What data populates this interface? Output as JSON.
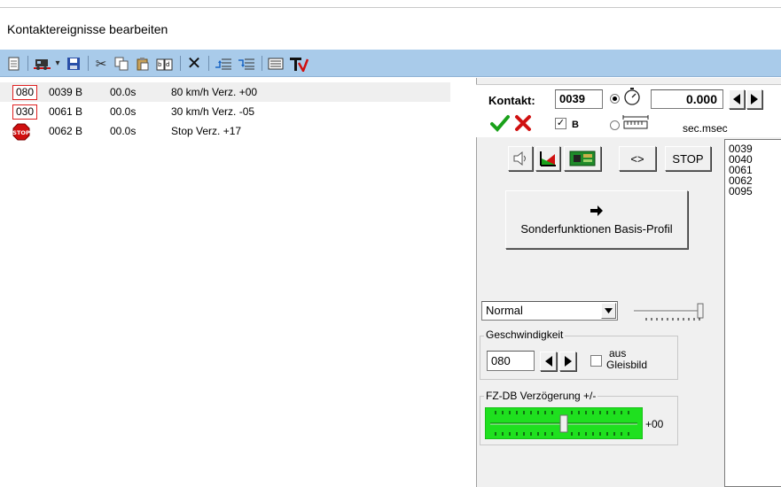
{
  "window": {
    "title": "Kontaktereignisse bearbeiten"
  },
  "toolbar": {
    "buttons": [
      {
        "name": "new-document-icon",
        "glyph": "🗎"
      },
      {
        "name": "train-icon",
        "glyph": "🚂"
      },
      {
        "name": "dropdown-arrow-icon",
        "glyph": "▾"
      },
      {
        "name": "save-icon",
        "glyph": "💾"
      },
      {
        "name": "cut-icon",
        "glyph": "✂"
      },
      {
        "name": "copy-icon",
        "glyph": "⎘"
      },
      {
        "name": "paste-icon",
        "glyph": "📋"
      },
      {
        "name": "paste-special-icon",
        "glyph": "🗐"
      },
      {
        "name": "delete-icon",
        "glyph": "✕"
      },
      {
        "name": "insert-before-icon",
        "glyph": "⇤"
      },
      {
        "name": "insert-after-icon",
        "glyph": "⇥"
      },
      {
        "name": "list-view-icon",
        "glyph": "▤"
      },
      {
        "name": "text-tool-icon",
        "glyph": "T"
      }
    ]
  },
  "events": [
    {
      "badge": "080",
      "badge_type": "speed",
      "contact": "0039 B",
      "time": "00.0s",
      "description": "80 km/h Verz. +00",
      "selected": true
    },
    {
      "badge": "030",
      "badge_type": "speed",
      "contact": "0061 B",
      "time": "00.0s",
      "description": "30 km/h Verz. -05",
      "selected": false
    },
    {
      "badge": "STOP",
      "badge_type": "stop",
      "contact": "0062 B",
      "time": "00.0s",
      "description": "Stop Verz. +17",
      "selected": false
    }
  ],
  "panel": {
    "contact_label": "Kontakt:",
    "contact_value": "0039",
    "time_value": "0.000",
    "time_unit": "sec.msec",
    "b_label": "B",
    "b_checked": true,
    "stop_button": "STOP",
    "swap_button": "<>",
    "special_button": "Sonderfunktionen Basis-Profil",
    "mode_select": "Normal",
    "speed_group": {
      "label": "Geschwindigkeit",
      "value": "080",
      "checkbox_label_1": "aus",
      "checkbox_label_2": "Gleisbild"
    },
    "delay_group": {
      "label": "FZ-DB Verzögerung +/-",
      "value_label": "+00",
      "slider_position": 0.5
    },
    "contacts_list": [
      "0039",
      "0040",
      "0061",
      "0062",
      "0095"
    ]
  },
  "colors": {
    "toolbar_bg": "#a9cbea",
    "badge_border": "#e02020",
    "slider_green": "#1fe01f",
    "check_green": "#1aa11a",
    "cancel_red": "#d01010"
  }
}
